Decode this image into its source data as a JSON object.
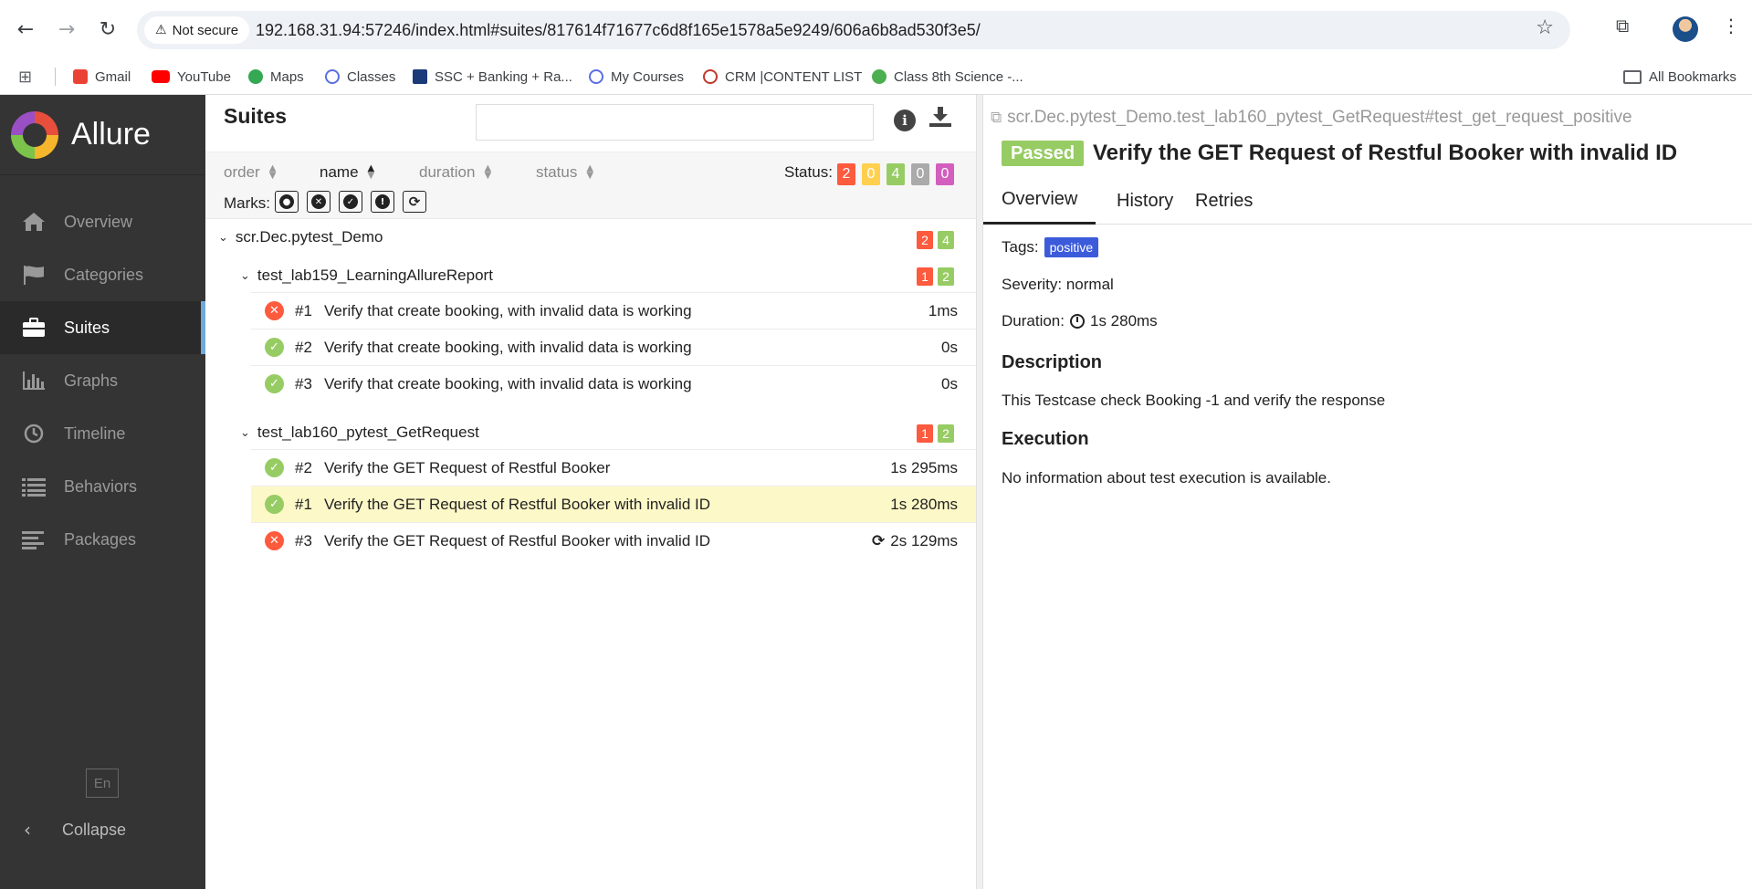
{
  "browser": {
    "security_label": "Not secure",
    "url": "192.168.31.94:57246/index.html#suites/817614f71677c6d8f165e1578a5e9249/606a6b8ad530f3e5/",
    "bookmarks": [
      "Gmail",
      "YouTube",
      "Maps",
      "Classes",
      "SSC + Banking + Ra...",
      "My Courses",
      "CRM |CONTENT LIST",
      "Class 8th Science -..."
    ],
    "all_bookmarks": "All Bookmarks"
  },
  "sidebar": {
    "brand": "Allure",
    "items": [
      {
        "label": "Overview",
        "icon": "home-icon"
      },
      {
        "label": "Categories",
        "icon": "flag-icon"
      },
      {
        "label": "Suites",
        "icon": "briefcase-icon"
      },
      {
        "label": "Graphs",
        "icon": "bar-chart-icon"
      },
      {
        "label": "Timeline",
        "icon": "clock-icon"
      },
      {
        "label": "Behaviors",
        "icon": "list-icon"
      },
      {
        "label": "Packages",
        "icon": "align-left-icon"
      }
    ],
    "active": "Suites",
    "language": "En",
    "collapse": "Collapse"
  },
  "suites": {
    "title": "Suites",
    "sort": {
      "order": "order",
      "name": "name",
      "duration": "duration",
      "status": "status",
      "active": "name"
    },
    "status_label": "Status:",
    "status_counts": [
      {
        "name": "failed",
        "value": "2",
        "color": "#fd5a3e"
      },
      {
        "name": "broken",
        "value": "0",
        "color": "#ffd050"
      },
      {
        "name": "passed",
        "value": "4",
        "color": "#97cc64"
      },
      {
        "name": "skipped",
        "value": "0",
        "color": "#aaaaaa"
      },
      {
        "name": "unknown",
        "value": "0",
        "color": "#d35ebe"
      }
    ],
    "marks_label": "Marks:",
    "root": {
      "name": "scr.Dec.pytest_Demo",
      "failed": "2",
      "passed": "4"
    },
    "groups": [
      {
        "name": "test_lab159_LearningAllureReport",
        "failed": "1",
        "passed": "2",
        "rows": [
          {
            "status": "failed",
            "num": "#1",
            "name": "Verify that create booking, with invalid data is working",
            "duration": "1ms"
          },
          {
            "status": "passed",
            "num": "#2",
            "name": "Verify that create booking, with invalid data is working",
            "duration": "0s"
          },
          {
            "status": "passed",
            "num": "#3",
            "name": "Verify that create booking, with invalid data is working",
            "duration": "0s"
          }
        ]
      },
      {
        "name": "test_lab160_pytest_GetRequest",
        "failed": "1",
        "passed": "2",
        "rows": [
          {
            "status": "passed",
            "num": "#2",
            "name": "Verify the GET Request of Restful Booker",
            "duration": "1s 295ms"
          },
          {
            "status": "passed",
            "num": "#1",
            "name": "Verify the GET Request of Restful Booker with invalid ID",
            "duration": "1s 280ms",
            "selected": true
          },
          {
            "status": "failed",
            "num": "#3",
            "name": "Verify the GET Request of Restful Booker with invalid ID",
            "duration": "2s 129ms",
            "retried": true
          }
        ]
      }
    ]
  },
  "detail": {
    "breadcrumb": "scr.Dec.pytest_Demo.test_lab160_pytest_GetRequest#test_get_request_positive",
    "status": "Passed",
    "title": "Verify the GET Request of Restful Booker with invalid ID",
    "tabs": [
      "Overview",
      "History",
      "Retries"
    ],
    "active_tab": "Overview",
    "tags_label": "Tags:",
    "tag": "positive",
    "severity": "Severity: normal",
    "duration_label": "Duration:",
    "duration": "1s 280ms",
    "description_heading": "Description",
    "description": "This Testcase check Booking -1 and verify the response",
    "execution_heading": "Execution",
    "execution_text": "No information about test execution is available."
  }
}
